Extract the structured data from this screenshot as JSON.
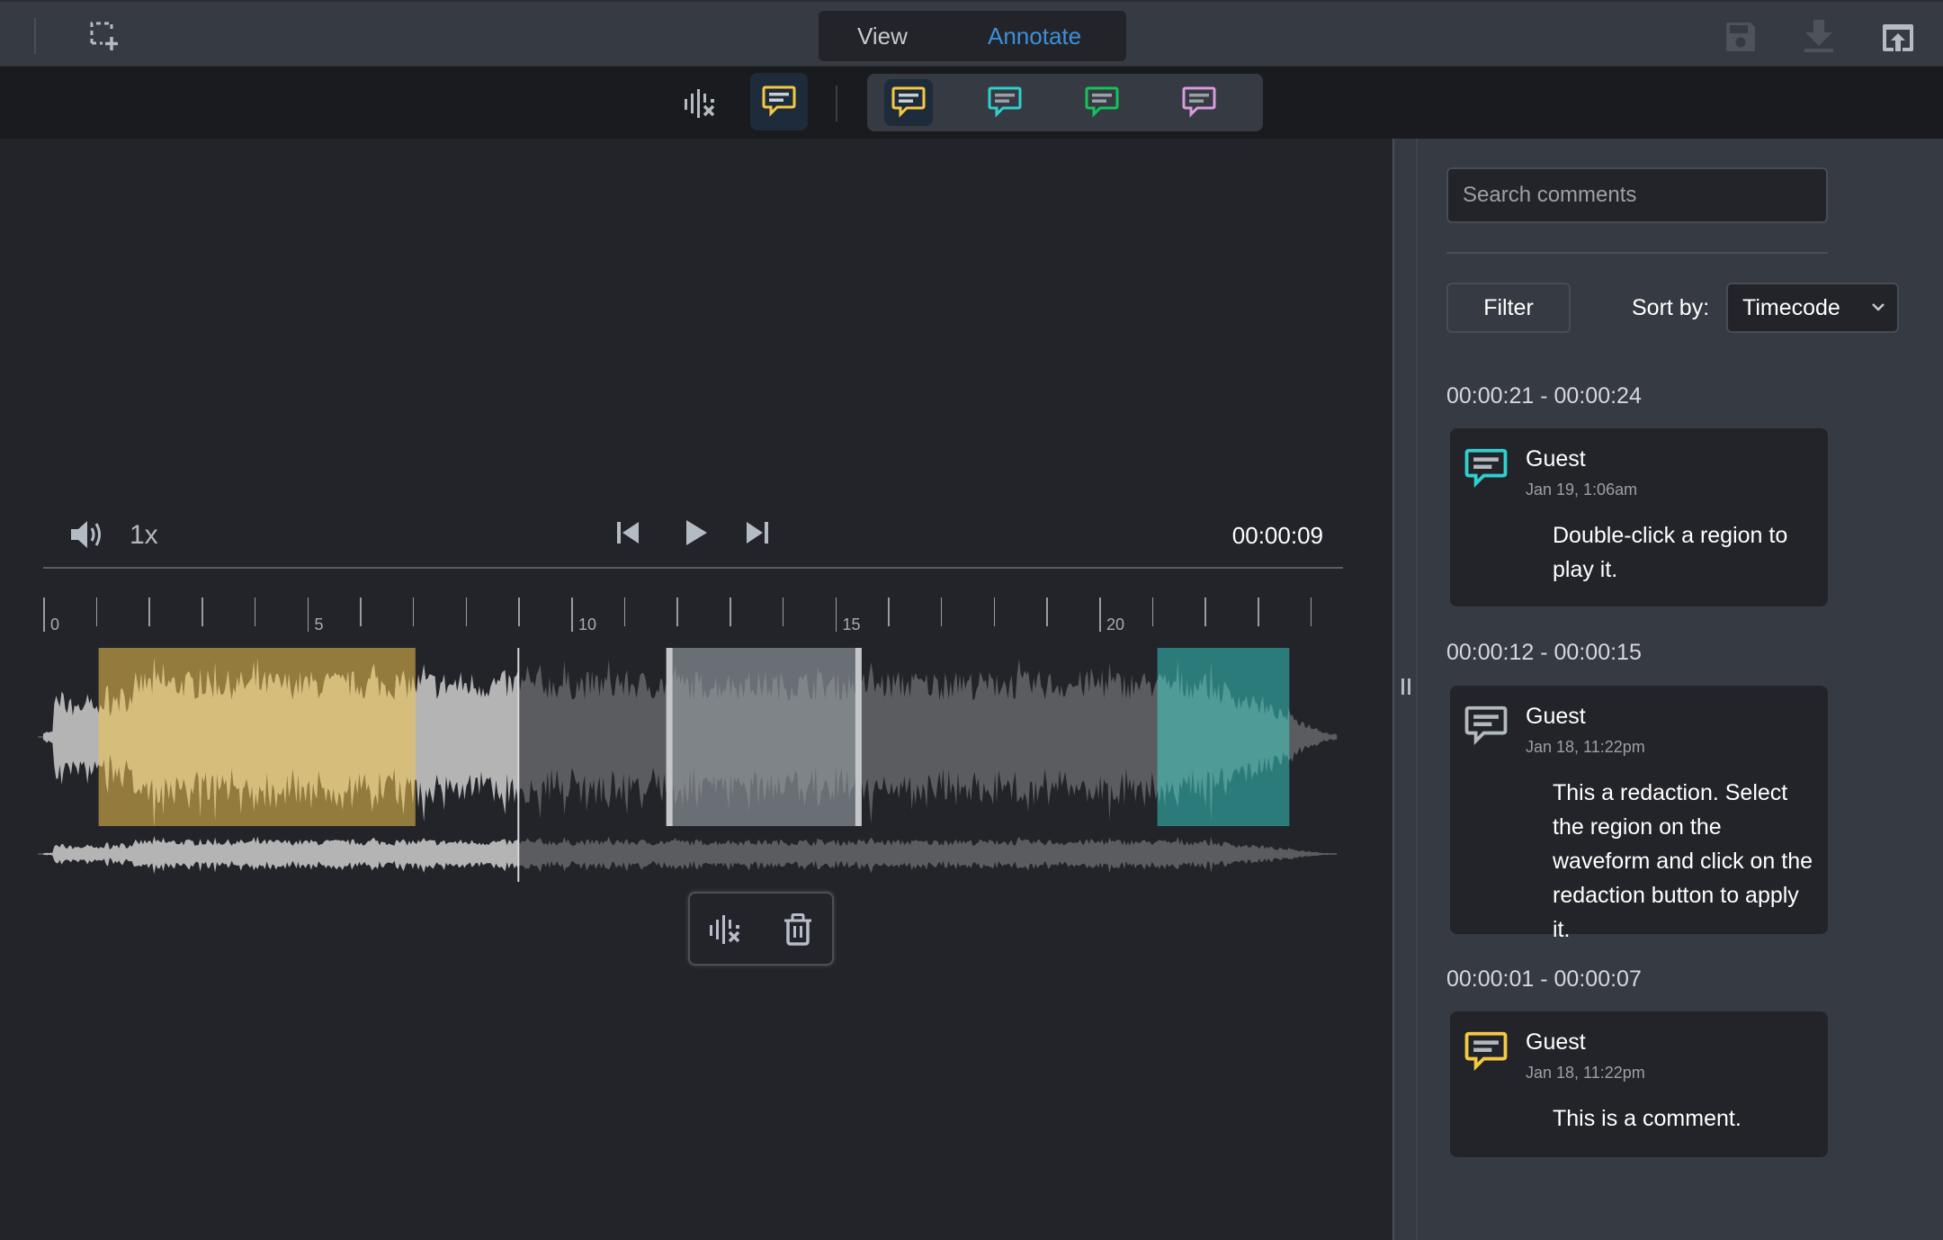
{
  "header": {
    "mode_tabs": [
      {
        "label": "View",
        "active": false
      },
      {
        "label": "Annotate",
        "active": true
      }
    ],
    "icons": {
      "select_region": "add-selection-icon",
      "save": "save-icon",
      "download": "download-icon",
      "open_external": "open-external-icon"
    }
  },
  "toolbar": {
    "tools": [
      {
        "icon": "redact-audio-icon",
        "active": false
      },
      {
        "icon": "comment-icon",
        "color": "#f5c842",
        "active": true
      }
    ],
    "comment_colors": [
      {
        "name": "yellow",
        "color": "#f5c842",
        "active": true
      },
      {
        "name": "cyan",
        "color": "#2fd0d0",
        "active": false
      },
      {
        "name": "green",
        "color": "#16c35a",
        "active": false
      },
      {
        "name": "pink",
        "color": "#d89be0",
        "active": false
      }
    ]
  },
  "player": {
    "volume_icon": "volume-icon",
    "speed": "1x",
    "timecode": "00:00:09",
    "playhead_seconds": 9.0,
    "duration_seconds": 24.5
  },
  "ruler": {
    "labels": [
      "0",
      "5",
      "10",
      "15",
      "20"
    ]
  },
  "regions": [
    {
      "type": "comment",
      "color": "#927b3d",
      "wave_color": "#d7bd7b",
      "start": 1.05,
      "end": 7.05
    },
    {
      "type": "redaction",
      "color": "#6a6e75",
      "wave_color": "#7f8489",
      "start": 11.8,
      "end": 15.5
    },
    {
      "type": "comment",
      "color": "#2c7b7b",
      "wave_color": "#4e9b98",
      "start": 21.1,
      "end": 23.6
    }
  ],
  "region_tools": {
    "redact_icon": "redact-audio-icon",
    "delete_icon": "trash-icon"
  },
  "sidebar": {
    "search_placeholder": "Search comments",
    "search_value": "",
    "filter_label": "Filter",
    "sort_label": "Sort by:",
    "sort_value": "Timecode",
    "groups": [
      {
        "range": "00:00:21 - 00:00:24",
        "comments": [
          {
            "author": "Guest",
            "date": "Jan 19, 1:06am",
            "text": "Double-click a region to play it.",
            "icon_color": "#2fd0d0"
          }
        ]
      },
      {
        "range": "00:00:12 - 00:00:15",
        "comments": [
          {
            "author": "Guest",
            "date": "Jan 18, 11:22pm",
            "text": "This a redaction. Select the region on the waveform and click on the redaction button to apply it.",
            "icon_color": "#b3b9c1"
          }
        ]
      },
      {
        "range": "00:00:01 - 00:00:07",
        "comments": [
          {
            "author": "Guest",
            "date": "Jan 18, 11:22pm",
            "text": "This is a comment.",
            "icon_color": "#f5c842"
          }
        ]
      }
    ]
  }
}
